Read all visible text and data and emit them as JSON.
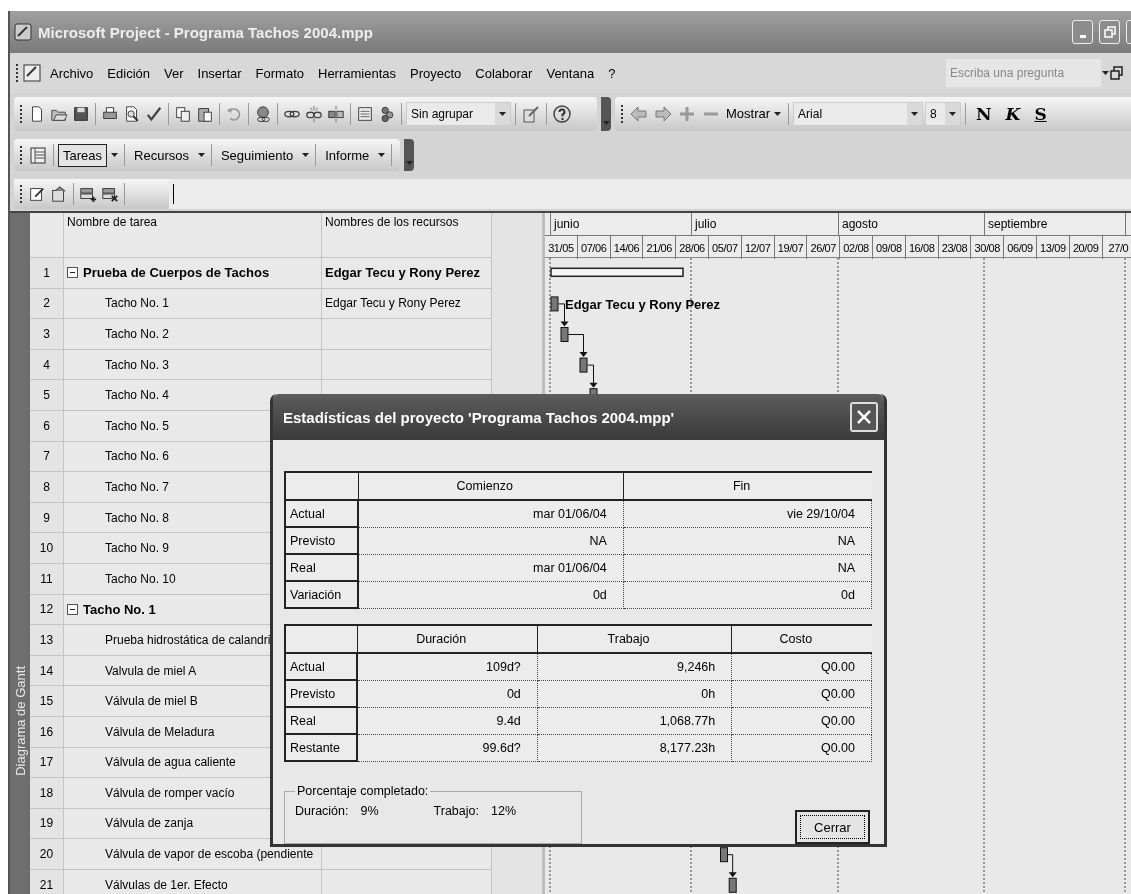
{
  "window": {
    "title": "Microsoft Project - Programa Tachos 2004.mpp"
  },
  "menu": [
    "Archivo",
    "Edición",
    "Ver",
    "Insertar",
    "Formato",
    "Herramientas",
    "Proyecto",
    "Colaborar",
    "Ventana",
    "?"
  ],
  "help_search": {
    "placeholder": "Escriba una pregunta"
  },
  "standard_toolbar": {
    "group_by": "Sin agrupar"
  },
  "formatting_toolbar": {
    "show_button": "Mostrar",
    "font": "Arial",
    "font_size": "8",
    "bold": "N",
    "italic": "K",
    "underline": "S"
  },
  "guide_toolbar": [
    {
      "label": "Tareas",
      "selected": true
    },
    {
      "label": "Recursos",
      "selected": false
    },
    {
      "label": "Seguimiento",
      "selected": false
    },
    {
      "label": "Informe",
      "selected": false
    }
  ],
  "view_bar": {
    "label": "Diagrama de Gantt"
  },
  "table": {
    "columns": [
      "Nombre de tarea",
      "Nombres de los recursos"
    ],
    "rows": [
      {
        "id": "1",
        "name": "Prueba de Cuerpos de Tachos",
        "resources": "Edgar Tecu y Rony Perez",
        "expanded": true,
        "children": [
          {
            "id": "2",
            "name": "Tacho No. 1",
            "resources": "Edgar Tecu y Rony Perez",
            "bar_label": "Edgar Tecu y Rony Perez"
          },
          {
            "id": "3",
            "name": "Tacho No. 2"
          },
          {
            "id": "4",
            "name": "Tacho No. 3"
          },
          {
            "id": "5",
            "name": "Tacho No. 4"
          },
          {
            "id": "6",
            "name": "Tacho No. 5"
          },
          {
            "id": "7",
            "name": "Tacho No. 6"
          },
          {
            "id": "8",
            "name": "Tacho No. 7"
          },
          {
            "id": "9",
            "name": "Tacho No. 8"
          },
          {
            "id": "10",
            "name": "Tacho No. 9"
          },
          {
            "id": "11",
            "name": "Tacho No. 10"
          }
        ]
      },
      {
        "id": "12",
        "name": "Tacho No. 1",
        "expanded": true,
        "children": [
          {
            "id": "13",
            "name": "Prueba hidrostática de calandri"
          },
          {
            "id": "14",
            "name": "Valvula de miel A"
          },
          {
            "id": "15",
            "name": "Válvula de miel B"
          },
          {
            "id": "16",
            "name": "Válvula de Meladura"
          },
          {
            "id": "17",
            "name": "Válvula de agua caliente"
          },
          {
            "id": "18",
            "name": "Válvula de romper vacío"
          },
          {
            "id": "19",
            "name": "Válvula de zanja"
          },
          {
            "id": "20",
            "name": "Válvula de vapor de escoba (pendiente"
          },
          {
            "id": "21",
            "name": "Válvulas de 1er. Efecto"
          }
        ]
      }
    ]
  },
  "gantt": {
    "months": [
      "junio",
      "julio",
      "agosto",
      "septiembre"
    ],
    "weeks": [
      "31/05",
      "07/06",
      "14/06",
      "21/06",
      "28/06",
      "05/07",
      "12/07",
      "19/07",
      "26/07",
      "02/08",
      "09/08",
      "16/08",
      "23/08",
      "30/08",
      "06/09",
      "13/09",
      "20/09",
      "27/0"
    ]
  },
  "dialog": {
    "title": "Estadísticas del proyecto 'Programa Tachos 2004.mpp'",
    "dates_table": {
      "columns": [
        "Comienzo",
        "Fin"
      ],
      "rows": [
        {
          "label": "Actual",
          "values": [
            "mar 01/06/04",
            "vie 29/10/04"
          ]
        },
        {
          "label": "Previsto",
          "values": [
            "NA",
            "NA"
          ]
        },
        {
          "label": "Real",
          "values": [
            "mar 01/06/04",
            "NA"
          ]
        },
        {
          "label": "Variación",
          "values": [
            "0d",
            "0d"
          ]
        }
      ]
    },
    "totals_table": {
      "columns": [
        "Duración",
        "Trabajo",
        "Costo"
      ],
      "rows": [
        {
          "label": "Actual",
          "values": [
            "109d?",
            "9,246h",
            "Q0.00"
          ]
        },
        {
          "label": "Previsto",
          "values": [
            "0d",
            "0h",
            "Q0.00"
          ]
        },
        {
          "label": "Real",
          "values": [
            "9.4d",
            "1,068.77h",
            "Q0.00"
          ]
        },
        {
          "label": "Restante",
          "values": [
            "99.6d?",
            "8,177.23h",
            "Q0.00"
          ]
        }
      ]
    },
    "percent_complete": {
      "legend": "Porcentaje completado:",
      "items": [
        {
          "label": "Duración:",
          "value": "9%"
        },
        {
          "label": "Trabajo:",
          "value": "12%"
        }
      ]
    },
    "close_button": "Cerrar"
  }
}
